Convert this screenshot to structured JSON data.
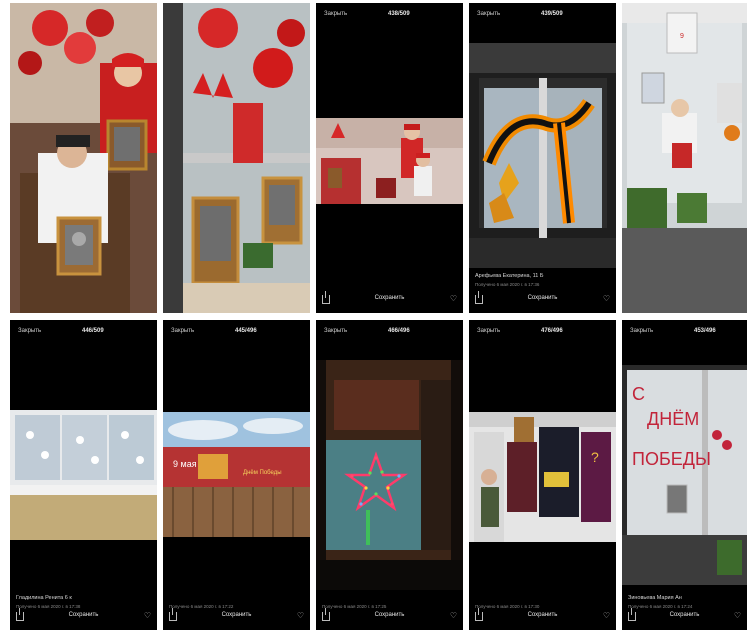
{
  "tiles": [
    {
      "close": "",
      "counter": "",
      "caption": "",
      "subcap": "",
      "save": "",
      "photo": "two-kids-saluting"
    },
    {
      "close": "",
      "counter": "",
      "caption": "",
      "subcap": "",
      "save": "",
      "photo": "window-balloons"
    },
    {
      "close": "Закрыть",
      "counter": "438/509",
      "caption": "",
      "subcap": "",
      "save": "Сохранить",
      "photo": "girls-saluting"
    },
    {
      "close": "Закрыть",
      "counter": "439/509",
      "caption": "Арефьева Екатерина, 11 Б",
      "subcap": "Получено 6 мая 2020 г. в 17:36",
      "save": "Сохранить",
      "photo": "window-ribbon"
    },
    {
      "close": "",
      "counter": "",
      "caption": "",
      "subcap": "",
      "save": "",
      "photo": "window-portraits"
    },
    {
      "close": "Закрыть",
      "counter": "446/509",
      "caption": "Гладилина Ренита 6 к",
      "subcap": "Получено 6 мая 2020 г. в 17:38",
      "save": "Сохранить",
      "photo": "window-doves"
    },
    {
      "close": "Закрыть",
      "counter": "445/496",
      "caption": "",
      "subcap": "Получено 6 мая 2020 г. в 17:22",
      "save": "Сохранить",
      "photo": "fence-banner"
    },
    {
      "close": "Закрыть",
      "counter": "466/496",
      "caption": "",
      "subcap": "Получено 6 мая 2020 г. в 17:25",
      "save": "Сохранить",
      "photo": "star-lights"
    },
    {
      "close": "Закрыть",
      "counter": "476/496",
      "caption": "",
      "subcap": "Получено 6 мая 2020 г. в 17:30",
      "save": "Сохранить",
      "photo": "window-collage"
    },
    {
      "close": "Закрыть",
      "counter": "453/496",
      "caption": "Зиновьева Мария Ан",
      "subcap": "Получено 6 мая 2020 г. в 17:24",
      "save": "Сохранить",
      "photo": "window-letters"
    }
  ],
  "window_text": {
    "words": [
      "С",
      "ДНЁМ",
      "ПОБЕДЫ"
    ]
  },
  "banner_text": "9 мая",
  "banner_text_right": "Днём Победы"
}
